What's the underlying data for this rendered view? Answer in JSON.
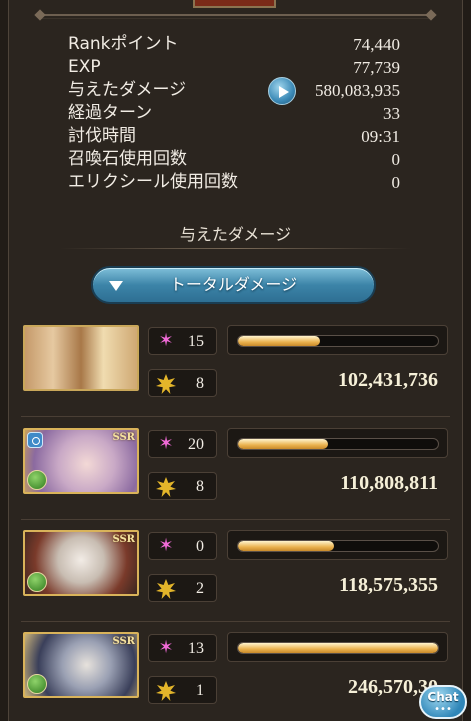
{
  "stats": [
    {
      "label": "Rankポイント",
      "value": "74,440"
    },
    {
      "label": "EXP",
      "value": "77,739"
    },
    {
      "label": "与えたダメージ",
      "value": "580,083,935"
    },
    {
      "label": "経過ターン",
      "value": "33"
    },
    {
      "label": "討伐時間",
      "value": "09:31"
    },
    {
      "label": "召喚石使用回数",
      "value": "0"
    },
    {
      "label": "エリクシール使用回数",
      "value": "0"
    }
  ],
  "section_title": "与えたダメージ",
  "total_button": {
    "label": "トータルダメージ"
  },
  "characters": [
    {
      "ssr": "",
      "skill_count": "15",
      "ougi_count": "8",
      "damage": "102,431,736",
      "share": 0.41
    },
    {
      "ssr": "SSR",
      "skill_count": "20",
      "ougi_count": "8",
      "damage": "110,808,811",
      "share": 0.45
    },
    {
      "ssr": "SSR",
      "skill_count": "0",
      "ougi_count": "2",
      "damage": "118,575,355",
      "share": 0.48
    },
    {
      "ssr": "SSR",
      "skill_count": "13",
      "ougi_count": "1",
      "damage": "246,570,30",
      "share": 1.0
    }
  ],
  "chat": {
    "label": "Chat",
    "dots": "•••"
  },
  "colors": {
    "accent": "#3c84a8",
    "bar": "#eab24f",
    "skill": "#f06ad7",
    "ougi": "#e3b52a"
  }
}
